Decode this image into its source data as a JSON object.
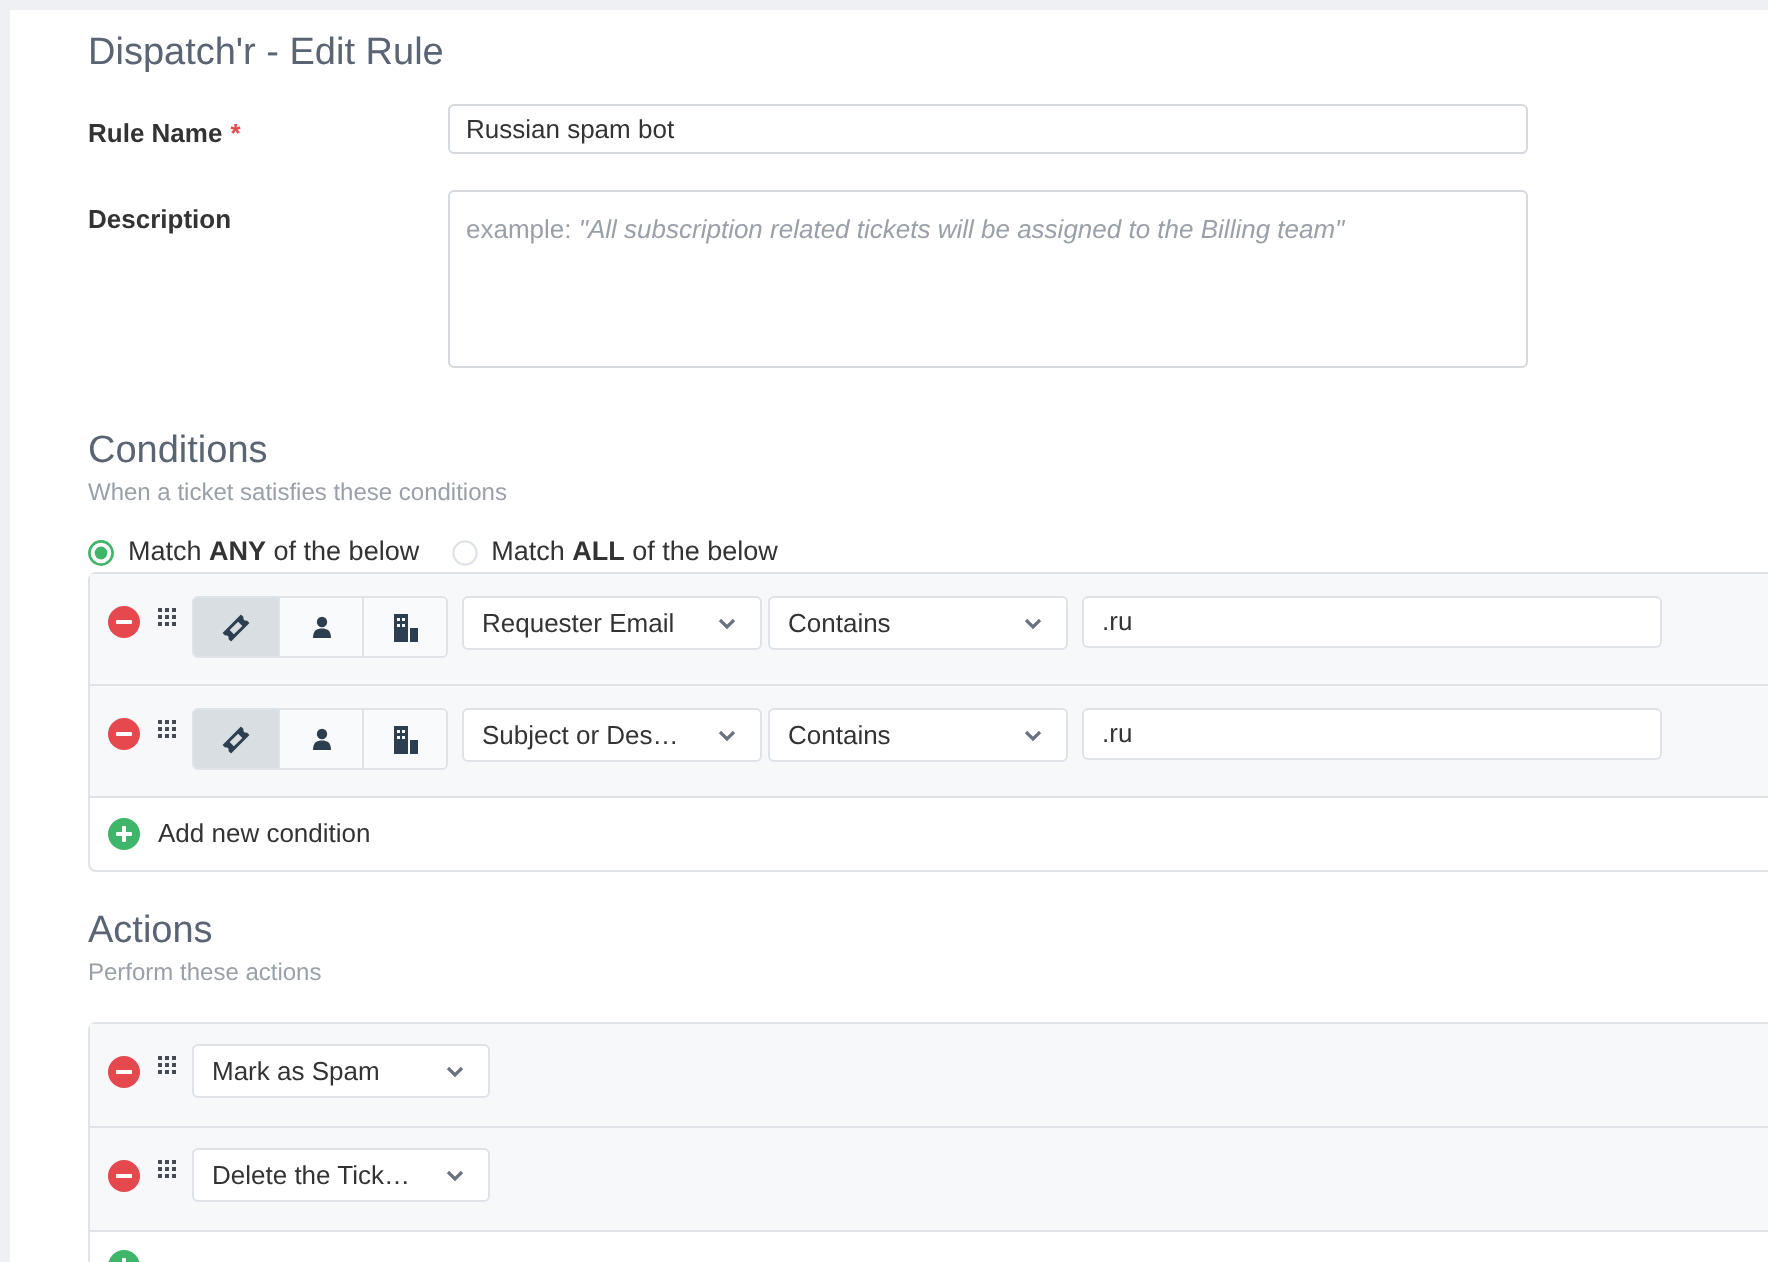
{
  "page": {
    "title": "Dispatch'r - Edit Rule"
  },
  "fields": [
    {
      "kind": "input",
      "label": "Rule Name",
      "required_marker": "*",
      "value": "Russian spam bot"
    },
    {
      "kind": "textarea",
      "label": "Description",
      "placeholder": "example: *\"All subscription related tickets will be assigned to the Billing team\"*"
    }
  ],
  "conditions": {
    "title": "Conditions",
    "subtitle": "When a ticket satisfies these conditions",
    "match_options": [
      {
        "label": "Match **ANY** of the below",
        "selected": true
      },
      {
        "label": "Match **ALL** of the below",
        "selected": false
      }
    ],
    "rows": [
      {
        "scopes": [
          {
            "kind": "ticket",
            "selected": true
          },
          {
            "kind": "person",
            "selected": false
          },
          {
            "kind": "building",
            "selected": false
          }
        ],
        "field": "Requester Email",
        "operator": "Contains",
        "value": ".ru"
      },
      {
        "scopes": [
          {
            "kind": "ticket",
            "selected": true
          },
          {
            "kind": "person",
            "selected": false
          },
          {
            "kind": "building",
            "selected": false
          }
        ],
        "field": "Subject or Des…",
        "operator": "Contains",
        "value": ".ru"
      }
    ],
    "add_label": "Add new condition"
  },
  "actions": {
    "title": "Actions",
    "subtitle": "Perform these actions",
    "rows": [
      {
        "action": "Mark as Spam"
      },
      {
        "action": "Delete the Tick…"
      }
    ]
  }
}
